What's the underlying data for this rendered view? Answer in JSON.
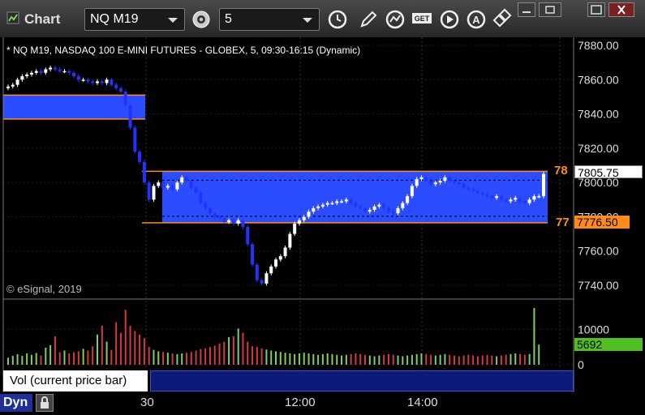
{
  "toolbar": {
    "window_title": "Chart",
    "symbol": "NQ M19",
    "interval": "5",
    "buttons": [
      "clock-icon",
      "pencil-icon",
      "chart-style-icon",
      "get-icon",
      "play-icon",
      "alert-icon",
      "link-icon"
    ]
  },
  "chart": {
    "description": "* NQ M19, NASDAQ 100 E-MINI FUTURES - GLOBEX, 5, 09:30-16:15 (Dynamic)",
    "copyright": "© eSignal, 2019",
    "price_axis": [
      "7880.00",
      "7860.00",
      "7840.00",
      "7820.00",
      "7800.00",
      "7780.00",
      "7760.00",
      "7740.00"
    ],
    "last_price": "7805.75",
    "lower_price": "7776.50",
    "upper_level_label": "78",
    "lower_level_label": "77",
    "colors": {
      "zone": "#2b4cff",
      "level": "#ff8c1a",
      "up": "#ffffff",
      "down": "#2233ff",
      "vol_up": "#7fd15a",
      "vol_down": "#d63a3a"
    }
  },
  "volume": {
    "axis": [
      "10000",
      "0"
    ],
    "last_volume": "5692",
    "study_label": "Vol (current price bar)",
    "close_glyph": "×"
  },
  "time_axis": [
    "30",
    "12:00",
    "14:00"
  ],
  "dyn_label": "Dyn",
  "chart_data": {
    "type": "candlestick",
    "ylim": [
      7735,
      7885
    ],
    "zones": [
      {
        "low": 7837,
        "high": 7851
      },
      {
        "low": 7776.5,
        "high": 7806.5
      }
    ],
    "closes": [
      7856,
      7857,
      7860,
      7862,
      7863,
      7864,
      7865,
      7864,
      7866,
      7867,
      7866,
      7865,
      7865,
      7864,
      7862,
      7860,
      7860,
      7859,
      7858,
      7859,
      7858,
      7860,
      7857,
      7855,
      7853,
      7845,
      7832,
      7818,
      7812,
      7800,
      7790,
      7798,
      7800,
      7797,
      7798,
      7796,
      7800,
      7803,
      7801,
      7797,
      7794,
      7788,
      7785,
      7782,
      7780,
      7779,
      7777,
      7778,
      7776,
      7778,
      7774,
      7764,
      7752,
      7743,
      7741,
      7747,
      7751,
      7755,
      7757,
      7762,
      7770,
      7776,
      7778,
      7780,
      7783,
      7785,
      7786,
      7787,
      7788,
      7788,
      7789,
      7789,
      7790,
      7788,
      7786,
      7785,
      7783,
      7784,
      7786,
      7787,
      7785,
      7783,
      7782,
      7785,
      7788,
      7792,
      7798,
      7802,
      7803,
      7801,
      7799,
      7800,
      7801,
      7803,
      7801,
      7800,
      7799,
      7797,
      7796,
      7795,
      7794,
      7793,
      7792,
      7791,
      7792,
      7790,
      7789,
      7790,
      7791,
      7789,
      7788,
      7790,
      7792,
      7792,
      7805
    ],
    "volumes": [
      2000,
      2500,
      3000,
      2500,
      3200,
      2800,
      3300,
      2600,
      4800,
      5500,
      8000,
      3500,
      4000,
      3200,
      3500,
      3800,
      4500,
      4000,
      5200,
      8500,
      11000,
      6500,
      4200,
      12000,
      9000,
      15500,
      11000,
      9500,
      8500,
      7500,
      5000,
      4200,
      3800,
      3600,
      3400,
      3200,
      3000,
      3200,
      3400,
      3600,
      4000,
      4400,
      4600,
      5000,
      5400,
      6000,
      6500,
      7800,
      8000,
      10200,
      9000,
      6500,
      5200,
      5000,
      4600,
      4300,
      4000,
      3800,
      3600,
      3400,
      3200,
      3000,
      3200,
      3400,
      3200,
      3000,
      2800,
      3000,
      3200,
      3000,
      2800,
      2600,
      2800,
      3000,
      3200,
      3000,
      2800,
      2600,
      2400,
      2600,
      2800,
      3000,
      2800,
      2600,
      2400,
      2600,
      2800,
      3000,
      3200,
      3000,
      2800,
      2600,
      2800,
      3000,
      2800,
      2600,
      2400,
      2600,
      2800,
      2600,
      2400,
      2600,
      2800,
      2600,
      2400,
      2600,
      2800,
      3000,
      3200,
      3000,
      2800,
      3000,
      16000,
      5692
    ]
  }
}
